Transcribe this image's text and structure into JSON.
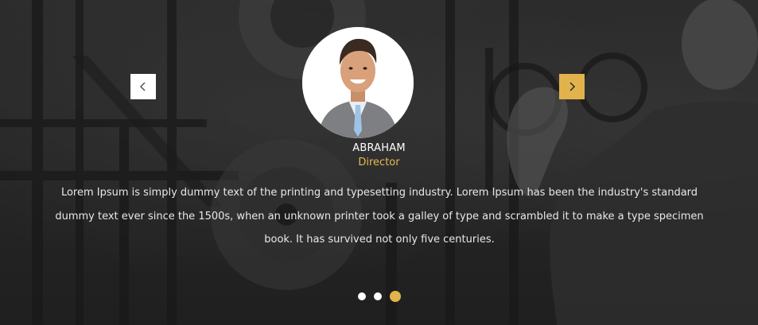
{
  "testimonial": {
    "name": "ABRAHAM",
    "role": "Director",
    "quote": "Lorem Ipsum is simply dummy text of the printing and typesetting industry. Lorem Ipsum has been the industry's standard dummy text ever since the 1500s, when an unknown printer took a galley of type and scrambled it to make a type specimen book. It has survived not only five centuries."
  },
  "navigation": {
    "prev_icon": "chevron-left-icon",
    "next_icon": "chevron-right-icon"
  },
  "pagination": {
    "total_slides": 3,
    "active_index": 2
  },
  "colors": {
    "accent": "#e2b34c",
    "role_text": "#e6b850",
    "text": "#e8e8e8"
  }
}
